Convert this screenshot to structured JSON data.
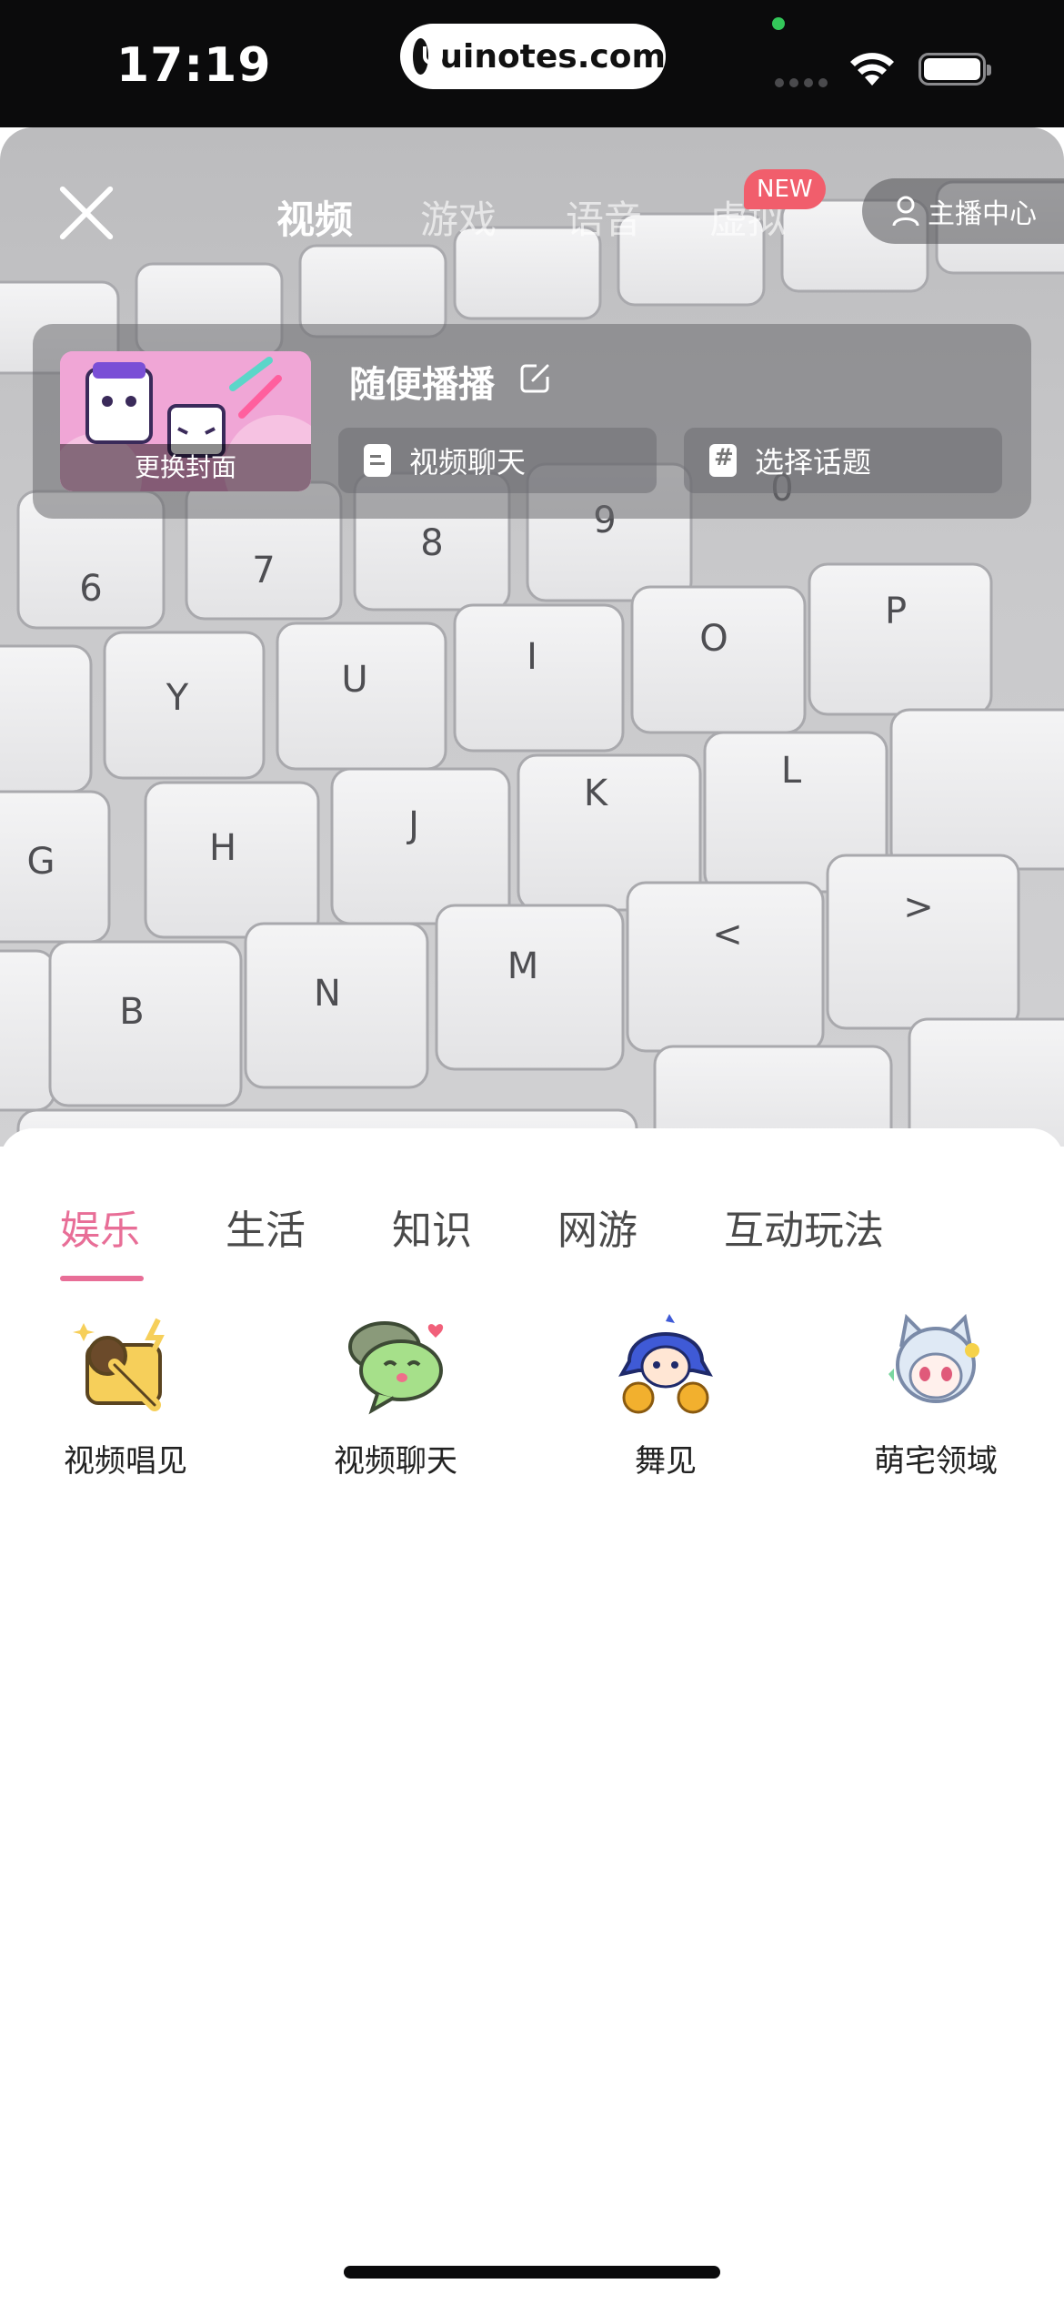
{
  "status_bar": {
    "time": "17:19",
    "url": "uinotes.com"
  },
  "top_bar": {
    "modes": [
      "视频",
      "游戏",
      "语音",
      "虚拟"
    ],
    "active_mode": "视频",
    "new_badge": "NEW",
    "host_center": "主播中心"
  },
  "room": {
    "title": "随便播播",
    "cover_caption": "更换封面",
    "chips": [
      "视频聊天",
      "选择话题"
    ]
  },
  "categories": {
    "tabs": [
      "娱乐",
      "生活",
      "知识",
      "网游",
      "互动玩法"
    ],
    "active": "娱乐",
    "items": [
      {
        "label": "视频唱见",
        "icon": "microphone-mascot-icon"
      },
      {
        "label": "视频聊天",
        "icon": "chat-bubble-mascot-icon"
      },
      {
        "label": "舞见",
        "icon": "dancer-mascot-icon"
      },
      {
        "label": "萌宅领域",
        "icon": "cat-girl-mascot-icon"
      }
    ]
  },
  "colors": {
    "accent": "#e86e97",
    "badge": "#f15e6c"
  }
}
